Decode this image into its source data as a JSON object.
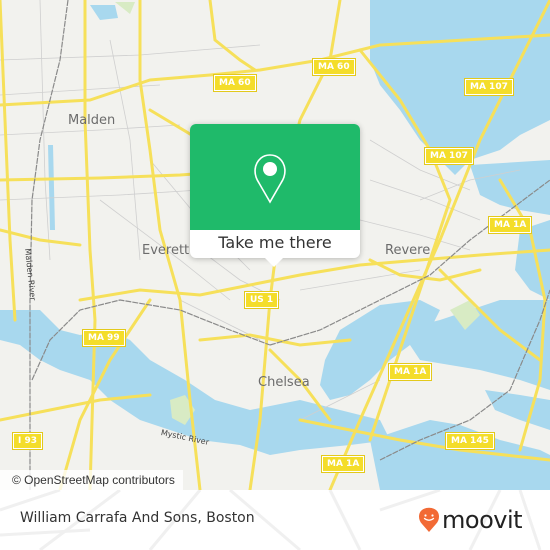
{
  "map": {
    "background_color": "#f2f2ee",
    "water_color": "#a8d8ee",
    "road_color": "#f6e05a",
    "places": [
      {
        "id": "malden",
        "label": "Malden"
      },
      {
        "id": "everett",
        "label": "Everett"
      },
      {
        "id": "revere",
        "label": "Revere"
      },
      {
        "id": "chelsea",
        "label": "Chelsea"
      }
    ],
    "rivers": [
      {
        "id": "malden-river",
        "label": "Malden River"
      },
      {
        "id": "mystic-river",
        "label": "Mystic River"
      }
    ],
    "shields": [
      {
        "id": "ma60-a",
        "label": "MA 60"
      },
      {
        "id": "ma60-b",
        "label": "MA 60"
      },
      {
        "id": "ma107-a",
        "label": "MA 107"
      },
      {
        "id": "ma107-b",
        "label": "MA 107"
      },
      {
        "id": "ma1a-a",
        "label": "MA 1A"
      },
      {
        "id": "us1",
        "label": "US 1"
      },
      {
        "id": "ma99",
        "label": "MA 99"
      },
      {
        "id": "ma1a-b",
        "label": "MA 1A"
      },
      {
        "id": "i93",
        "label": "I 93"
      },
      {
        "id": "ma145",
        "label": "MA 145"
      },
      {
        "id": "ma1a-c",
        "label": "MA 1A"
      }
    ],
    "attribution": "© OpenStreetMap contributors"
  },
  "popup": {
    "icon": "map-pin-icon",
    "accent_color": "#1fba6a",
    "button_label": "Take me there"
  },
  "footer": {
    "title": "William Carrafa And Sons, Boston",
    "brand": "moovit",
    "brand_color": "#f26a35"
  }
}
